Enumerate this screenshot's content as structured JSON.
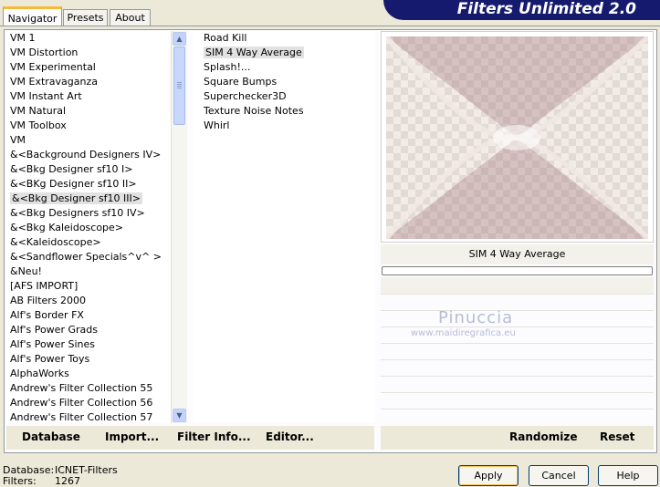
{
  "tabs": [
    {
      "label": "Navigator",
      "active": true
    },
    {
      "label": "Presets",
      "active": false
    },
    {
      "label": "About",
      "active": false
    }
  ],
  "banner": {
    "title": "Filters Unlimited 2.0"
  },
  "categories": {
    "selected": "&<Bkg Designer sf10 III>",
    "items": [
      "VM 1",
      "VM Distortion",
      "VM Experimental",
      "VM Extravaganza",
      "VM Instant Art",
      "VM Natural",
      "VM Toolbox",
      "VM",
      "&<Background Designers IV>",
      "&<Bkg Designer sf10 I>",
      "&<BKg Designer sf10 II>",
      "&<Bkg Designer sf10 III>",
      "&<Bkg Designers sf10 IV>",
      "&<Bkg Kaleidoscope>",
      "&<Kaleidoscope>",
      "&<Sandflower Specials^v^ >",
      "&Neu!",
      "[AFS IMPORT]",
      "AB Filters 2000",
      "Alf's Border FX",
      "Alf's Power Grads",
      "Alf's Power Sines",
      "Alf's Power Toys",
      "AlphaWorks",
      "Andrew's Filter Collection 55",
      "Andrew's Filter Collection 56",
      "Andrew's Filter Collection 57"
    ]
  },
  "filters": {
    "selected": "SIM 4 Way Average",
    "items": [
      "Road Kill",
      "SIM 4 Way Average",
      "Splash!...",
      "Square Bumps",
      "Superchecker3D",
      "Texture Noise Notes",
      "Whirl"
    ]
  },
  "preview": {
    "filter_name": "SIM 4 Way Average",
    "progress": 0
  },
  "watermark": {
    "name": "Pinuccia",
    "url": "www.maidiregrafica.eu"
  },
  "left_buttons": {
    "database": "Database",
    "import": "Import...",
    "filter_info": "Filter Info...",
    "editor": "Editor..."
  },
  "right_buttons": {
    "randomize": "Randomize",
    "reset": "Reset"
  },
  "status": {
    "database_label": "Database:",
    "database_value": "ICNET-Filters",
    "filters_label": "Filters:",
    "filters_value": "1267"
  },
  "dialog": {
    "apply": "Apply",
    "cancel": "Cancel",
    "help": "Help"
  },
  "colors": {
    "banner": "#161a6e",
    "selection": "#e1e1e1",
    "preview_tint": "#c9adad"
  }
}
